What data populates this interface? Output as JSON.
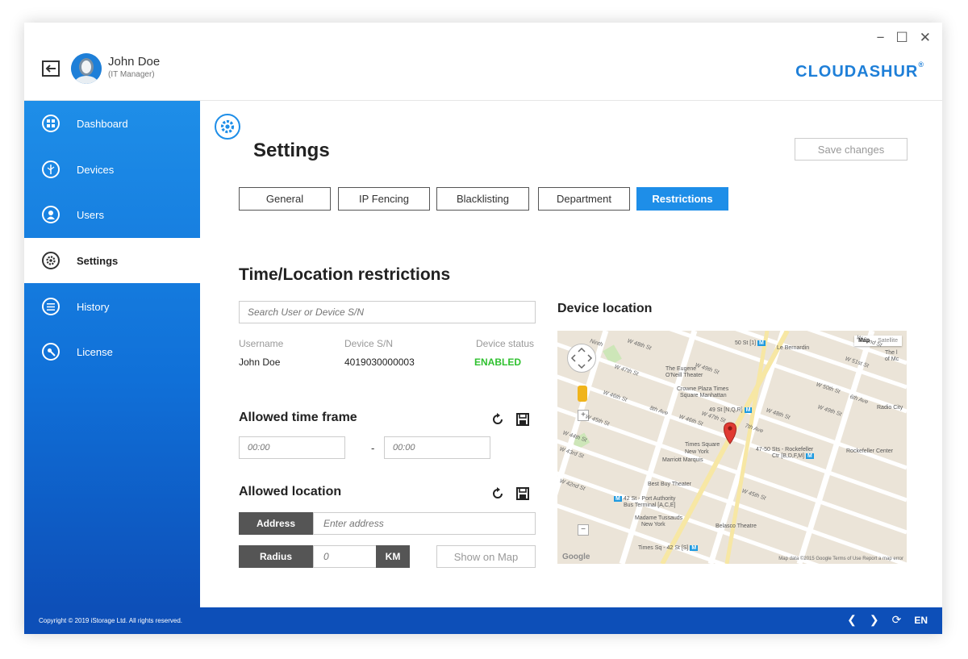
{
  "window": {
    "minimize": "−",
    "maximize": "☐",
    "close": "✕"
  },
  "brand": {
    "name": "CLOUDASHUR",
    "mark": "®",
    "color": "#1e7fd8"
  },
  "user": {
    "name": "John Doe",
    "role": "(IT Manager)"
  },
  "sidebar": {
    "items": [
      {
        "label": "Dashboard",
        "icon": "dashboard-icon"
      },
      {
        "label": "Devices",
        "icon": "usb-icon"
      },
      {
        "label": "Users",
        "icon": "user-icon"
      },
      {
        "label": "Settings",
        "icon": "gear-icon",
        "active": true
      },
      {
        "label": "History",
        "icon": "list-icon"
      },
      {
        "label": "License",
        "icon": "key-icon"
      }
    ]
  },
  "page": {
    "title": "Settings",
    "save_label": "Save changes"
  },
  "tabs": [
    {
      "label": "General"
    },
    {
      "label": "IP Fencing"
    },
    {
      "label": "Blacklisting"
    },
    {
      "label": "Department"
    },
    {
      "label": "Restrictions",
      "active": true
    }
  ],
  "restrictions": {
    "title": "Time/Location restrictions",
    "search_placeholder": "Search User or Device S/N",
    "columns": [
      "Username",
      "Device S/N",
      "Device status"
    ],
    "row": {
      "username": "John Doe",
      "serial": "4019030000003",
      "status": "ENABLED"
    },
    "status_color": "#2fc12f"
  },
  "time_frame": {
    "title": "Allowed time frame",
    "start_placeholder": "00:00",
    "end_placeholder": "00:00",
    "separator": "-"
  },
  "location": {
    "title": "Allowed location",
    "address_label": "Address",
    "address_placeholder": "Enter address",
    "radius_label": "Radius",
    "radius_placeholder": "0",
    "unit_label": "KM",
    "show_map_label": "Show on Map"
  },
  "map": {
    "title": "Device location",
    "type_map": "Map",
    "type_satellite": "Satellite",
    "labels": {
      "eugene": "The Eugene",
      "oneill": "O'Neill Theater",
      "crowne1": "Crowne Plaza Times",
      "crowne2": "Square Manhattan",
      "st49": "49 St [N,Q,R]",
      "st50": "50 St [1]",
      "bernardin": "Le Bernardin",
      "times_square": "Times Square",
      "new_york": "New York",
      "marriott": "Marriott Marquis",
      "rock_sts1": "47-50 Sts - Rockefeller",
      "rock_sts2": "Ctr [B,D,F,M]",
      "rock_center": "Rockefeller Center",
      "radio_city": "Radio City",
      "best_buy": "Best Buy Theater",
      "port_auth1": "42 St - Port Authority",
      "port_auth2": "Bus Terminal [A,C,E]",
      "tussauds1": "Madame Tussauds",
      "tussauds2": "New York",
      "belasco": "Belasco Theatre",
      "times_sq_42": "Times Sq - 42 St [S]",
      "the_l": "The l",
      "of_mc": "of Mc",
      "metro_m": "M"
    },
    "streets": {
      "w48a": "W 48th St",
      "w47a": "W 47th St",
      "w46a": "W 46th St",
      "w45a": "W 45th St",
      "w44": "W 44th St",
      "w43": "W 43rd St",
      "w42": "W 42nd St",
      "w49": "W 49th St",
      "w50": "W 50th St",
      "w51": "W 51st St",
      "w52": "W 52nd St",
      "w48b": "W 48th St",
      "w47b": "W 47th St",
      "w46b": "W 46th St",
      "w45b": "W 45th St",
      "w49b": "W 49th St",
      "ninth": "Ninth",
      "eighth": "8th Ave",
      "seventh": "7th Ave",
      "sixth": "6th Ave"
    },
    "attribution": "Map data ©2015 Google   Terms of Use   Report a map error",
    "google": "Google"
  },
  "footer": {
    "copyright": "Copyright © 2019 iStorage Ltd. All rights reserved.",
    "prev": "❮",
    "next": "❯",
    "refresh": "⟳",
    "lang": "EN"
  }
}
